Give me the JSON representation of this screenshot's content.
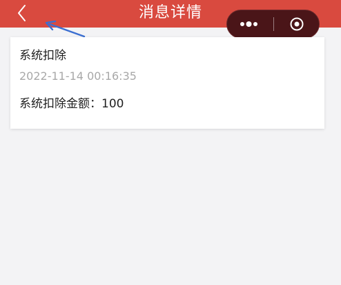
{
  "header": {
    "title": "消息详情",
    "back_icon": "chevron-left-icon",
    "more_icon": "more-dots-icon",
    "close_icon": "target-circle-icon",
    "background_color": "#d94a3f",
    "capsule_color": "#4a1518"
  },
  "annotation": {
    "arrow_icon": "arrow-icon",
    "color": "#3b6fd1"
  },
  "message": {
    "title": "系统扣除",
    "timestamp": "2022-11-14 00:16:35",
    "body": "系统扣除金额：100"
  }
}
